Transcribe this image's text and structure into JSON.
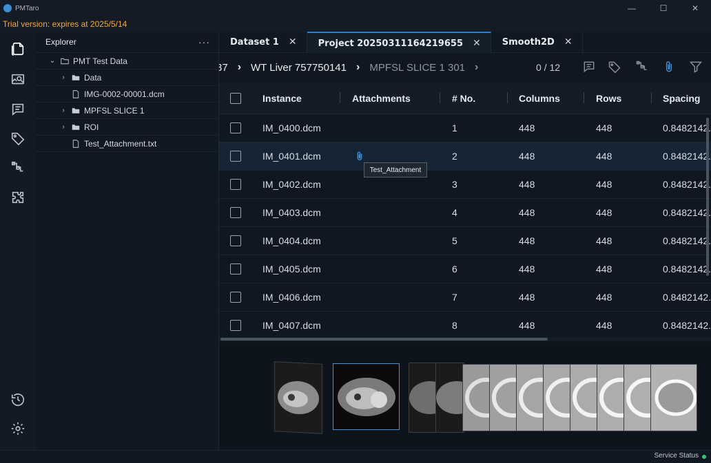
{
  "app": {
    "name": "PMTaro",
    "trial_text": "Trial version: expires at 2025/5/14"
  },
  "window_controls": {
    "minimize": "—",
    "maximize": "☐",
    "close": "✕"
  },
  "activity_bar": [
    "files-icon",
    "image-viewer-icon",
    "comments-icon",
    "tags-icon",
    "workflow-icon",
    "extensions-icon",
    "history-icon",
    "settings-icon"
  ],
  "explorer": {
    "title": "Explorer",
    "more": "···",
    "items": [
      {
        "label": "PMT Test Data",
        "type": "folder-open",
        "depth": 0
      },
      {
        "label": "Data",
        "type": "folder",
        "depth": 1
      },
      {
        "label": "IMG-0002-00001.dcm",
        "type": "file",
        "depth": 1
      },
      {
        "label": "MPFSL SLICE 1",
        "type": "folder",
        "depth": 1
      },
      {
        "label": "ROI",
        "type": "folder",
        "depth": 1
      },
      {
        "label": "Test_Attachment.txt",
        "type": "file",
        "depth": 1
      }
    ]
  },
  "tabs": [
    {
      "label": "Dataset 1",
      "active": false
    },
    {
      "label": "Project 20250311164219655",
      "active": true
    },
    {
      "label": "Smooth2D",
      "active": false
    }
  ],
  "breadcrumb": {
    "partial": "37",
    "current": "WT Liver 757750141",
    "next": "MPFSL SLICE 1 301",
    "pager": "0 / 12"
  },
  "table": {
    "headers": [
      "Instance",
      "Attachments",
      "# No.",
      "Columns",
      "Rows",
      "Spacing"
    ],
    "rows": [
      {
        "instance": "IM_0400.dcm",
        "no": "1",
        "columns": "448",
        "rows": "448",
        "spacing": "0.8482142...",
        "attachment": false
      },
      {
        "instance": "IM_0401.dcm",
        "no": "2",
        "columns": "448",
        "rows": "448",
        "spacing": "0.8482142...",
        "attachment": true
      },
      {
        "instance": "IM_0402.dcm",
        "no": "3",
        "columns": "448",
        "rows": "448",
        "spacing": "0.8482142...",
        "attachment": false
      },
      {
        "instance": "IM_0403.dcm",
        "no": "4",
        "columns": "448",
        "rows": "448",
        "spacing": "0.8482142...",
        "attachment": false
      },
      {
        "instance": "IM_0404.dcm",
        "no": "5",
        "columns": "448",
        "rows": "448",
        "spacing": "0.8482142...",
        "attachment": false
      },
      {
        "instance": "IM_0405.dcm",
        "no": "6",
        "columns": "448",
        "rows": "448",
        "spacing": "0.8482142...",
        "attachment": false
      },
      {
        "instance": "IM_0406.dcm",
        "no": "7",
        "columns": "448",
        "rows": "448",
        "spacing": "0.8482142...",
        "attachment": false
      },
      {
        "instance": "IM_0407.dcm",
        "no": "8",
        "columns": "448",
        "rows": "448",
        "spacing": "0.8482142...",
        "attachment": false
      }
    ]
  },
  "tooltip": "Test_Attachment",
  "status": {
    "label": "Service Status"
  },
  "colors": {
    "accent": "#3f93e0",
    "trial": "#f2a93b",
    "status_ok": "#3bc46b"
  }
}
